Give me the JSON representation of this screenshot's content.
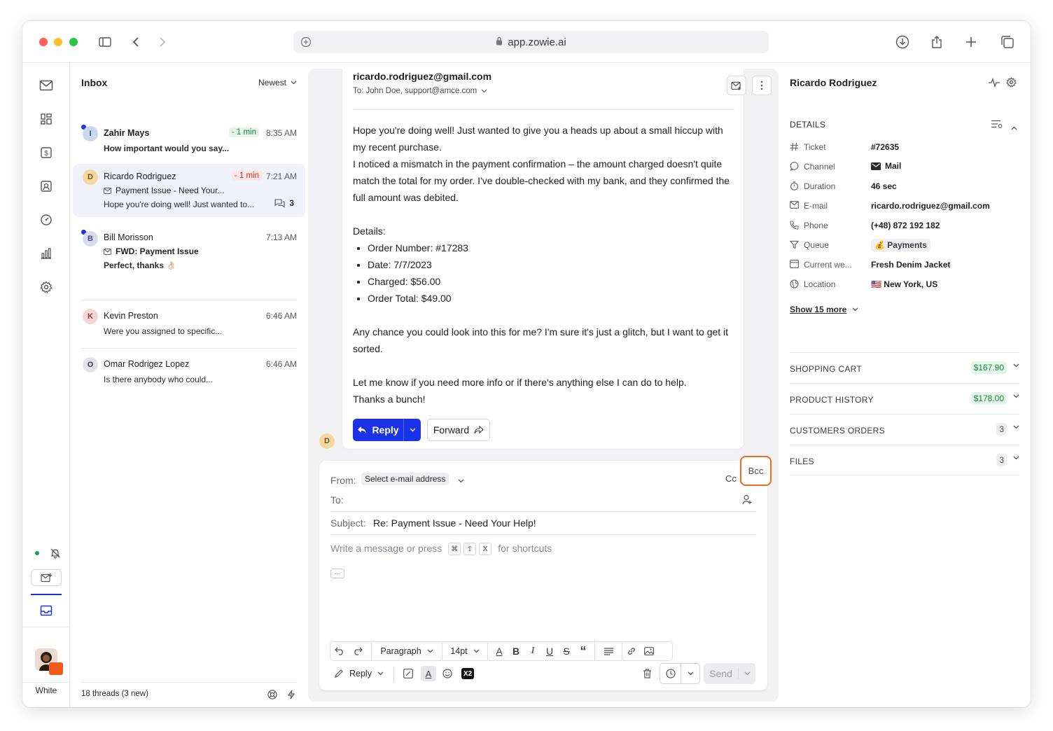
{
  "browser": {
    "url": "app.zowie.ai"
  },
  "rail": {
    "user_label": "White"
  },
  "inbox": {
    "title": "Inbox",
    "sort_label": "Newest",
    "threads": [
      {
        "initial": "I",
        "name": "Zahir Mays",
        "badge": "- 1 min",
        "time": "8:35 AM",
        "subject": "",
        "snippet": "How important would you say..."
      },
      {
        "initial": "D",
        "name": "Ricardo Rodriguez",
        "badge": "- 1 min",
        "time": "7:21 AM",
        "subject": "Payment Issue - Need Your...",
        "snippet": "Hope you're doing well! Just wanted to...",
        "count": "3"
      },
      {
        "initial": "B",
        "name": "Bill Morisson",
        "badge": "",
        "time": "7:13 AM",
        "subject": "FWD: Payment Issue",
        "snippet": "Perfect, thanks 👌🏻"
      },
      {
        "initial": "K",
        "name": "Kevin Preston",
        "badge": "",
        "time": "6:46 AM",
        "subject": "",
        "snippet": "Were you assigned to specific..."
      },
      {
        "initial": "O",
        "name": "Omar Rodrigez Lopez",
        "badge": "",
        "time": "6:46 AM",
        "subject": "",
        "snippet": "Is there anybody who could..."
      }
    ],
    "footer_count": "18 threads",
    "footer_new": "(3 new)"
  },
  "message": {
    "from": "ricardo.rodriguez@gmail.com",
    "to": "To: John Doe, support@amce.com",
    "body_p1": "Hope you're doing well! Just wanted to give you a heads up about a small hiccup with my recent purchase.",
    "body_p2": "I noticed a mismatch in the payment confirmation – the amount charged doesn't quite match the total for my order. I've double-checked with my bank, and they confirmed the full amount was debited.",
    "details_label": "Details:",
    "details": [
      "Order Number: #17283",
      "Date: 7/7/2023",
      "Charged: $56.00",
      "Order Total: $49.00"
    ],
    "body_p3": "Any chance you could look into this for me? I'm sure it's just a glitch, but I want to get it sorted.",
    "body_p4": "Let me know if you need more info or if there's anything else I can do to help.",
    "body_p5": "Thanks a bunch!",
    "reply_label": "Reply",
    "forward_label": "Forward",
    "avatar_initial": "D"
  },
  "compose": {
    "from_label": "From:",
    "from_select": "Select e-mail address",
    "cc_label": "Cc",
    "bcc_label": "Bcc",
    "to_label": "To:",
    "subject_label": "Subject:",
    "subject_value": "Re: Payment Issue - Need Your Help!",
    "placeholder_start": "Write a message or press",
    "placeholder_keys": [
      "⌘",
      "⇧",
      "X"
    ],
    "placeholder_end": "for shortcuts",
    "more_label": "···",
    "paragraph_label": "Paragraph",
    "size_label": "14pt",
    "mode_label": "Reply",
    "x2_label": "X2",
    "send_label": "Send"
  },
  "customer": {
    "name": "Ricardo Rodriguez",
    "details_title": "DETAILS",
    "rows": [
      {
        "label": "Ticket",
        "value": "#72635"
      },
      {
        "label": "Channel",
        "value": "Mail"
      },
      {
        "label": "Duration",
        "value": "46 sec"
      },
      {
        "label": "E-mail",
        "value": "ricardo.rodriguez@gmail.com"
      },
      {
        "label": "Phone",
        "value": "(+48) 872 192 182"
      },
      {
        "label": "Queue",
        "value": "💰 Payments"
      },
      {
        "label": "Current we...",
        "value": "Fresh Denim Jacket"
      },
      {
        "label": "Location",
        "value": "🇺🇸 New York, US"
      }
    ],
    "show_more": "Show 15 more",
    "sections": [
      {
        "label": "SHOPPING CART",
        "value": "$167.90"
      },
      {
        "label": "PRODUCT HISTORY",
        "value": "$178.00"
      },
      {
        "label": "CUSTOMERS ORDERS",
        "value": "3"
      },
      {
        "label": "FILES",
        "value": "3"
      }
    ]
  },
  "colors": {
    "accent": "#1a33e8",
    "highlight": "#f26a1b",
    "positive": "#178a3e",
    "negative": "#d62828"
  }
}
